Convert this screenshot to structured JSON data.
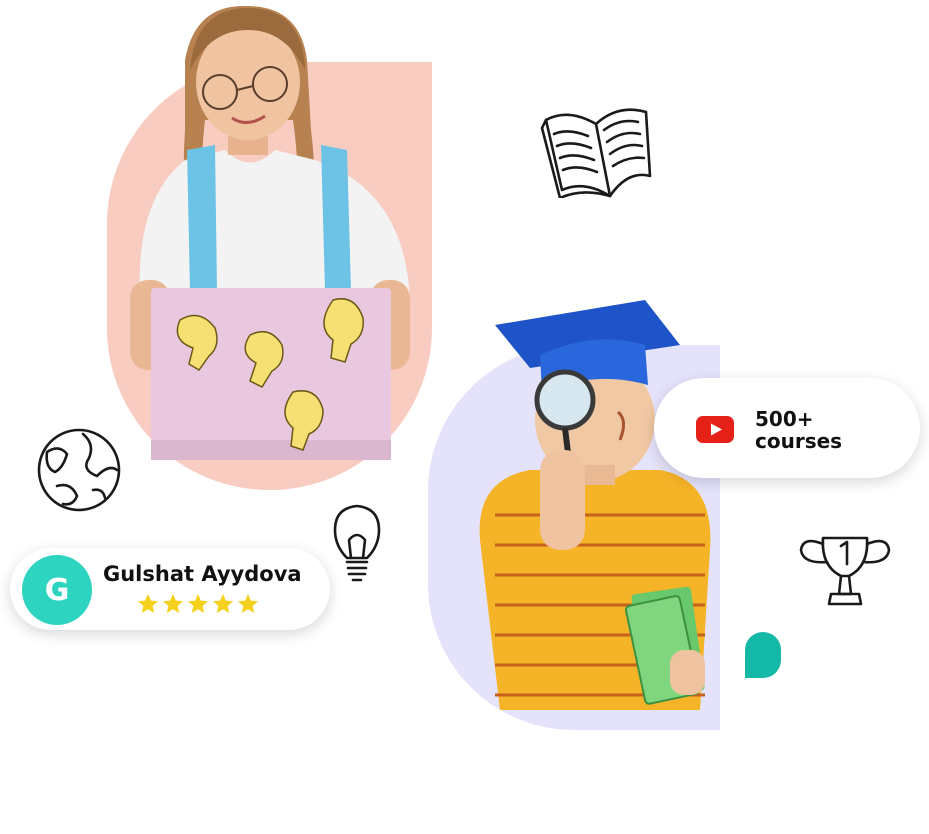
{
  "review": {
    "avatar_letter": "G",
    "name": "Gulshat Ayydova",
    "rating": 5
  },
  "courses": {
    "icon": "youtube-play-icon",
    "count": "500+",
    "label": "courses"
  },
  "colors": {
    "pink_blob": "#f9ccc2",
    "lavender_blob": "#e5e3fb",
    "avatar_teal": "#2dd4bf",
    "accent_teal": "#14b8a6",
    "star_yellow": "#f5d11d",
    "youtube_red": "#e62117"
  },
  "doodles": [
    "open-book-icon",
    "globe-icon",
    "lightbulb-icon",
    "trophy-icon"
  ]
}
